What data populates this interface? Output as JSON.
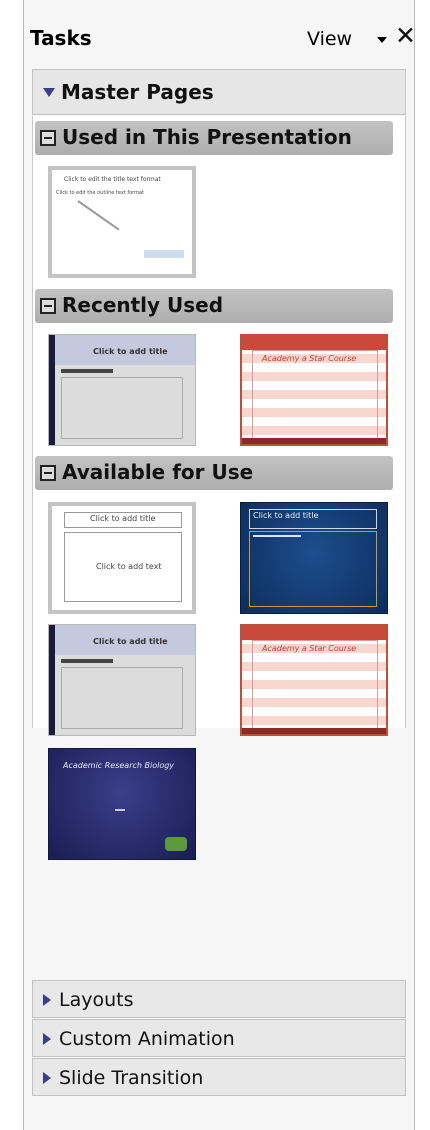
{
  "panel": {
    "title": "Tasks",
    "view_label": "View"
  },
  "master_pages": {
    "label": "Master Pages",
    "sections": {
      "used": {
        "label": "Used in This Presentation",
        "thumbs": [
          {
            "title": "Click to edit the title text format",
            "body": "Click to edit the outline text format"
          }
        ]
      },
      "recent": {
        "label": "Recently Used",
        "thumbs": [
          {
            "title": "Click to add title"
          },
          {
            "title": "Academy a Star Course"
          }
        ]
      },
      "available": {
        "label": "Available for Use",
        "thumbs": [
          {
            "title": "Click to add title",
            "body": "Click to add text"
          },
          {
            "title": "Click to add title"
          },
          {
            "title": "Click to add title"
          },
          {
            "title": "Academy a Star Course"
          },
          {
            "title": "Academic Research Biology"
          }
        ]
      }
    }
  },
  "panels": {
    "layouts": "Layouts",
    "custom_animation": "Custom Animation",
    "slide_transition": "Slide Transition"
  },
  "colors": {
    "section_header": "#b8b8b8",
    "triangle": "#3b3e8f",
    "red_stripe": "#b9523a",
    "blue_theme": "#0d2d5c",
    "navy_theme": "#1a1d52"
  }
}
